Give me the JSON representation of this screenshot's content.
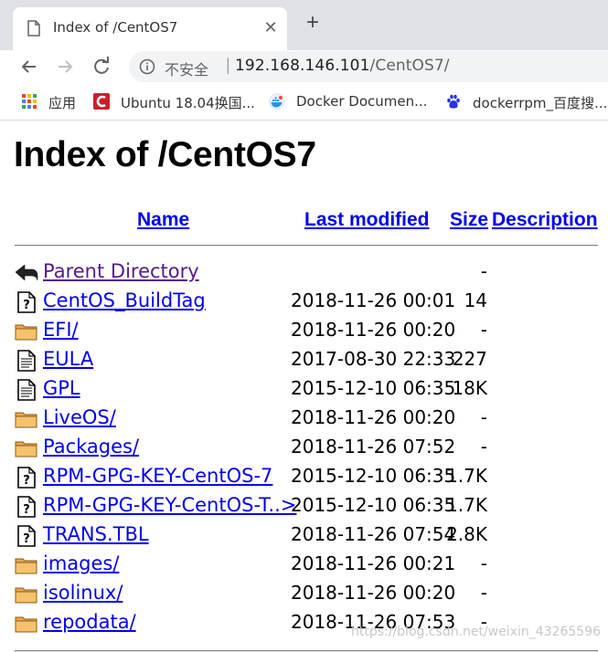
{
  "tab": {
    "title": "Index of /CentOS7",
    "close_glyph": "✕",
    "new_tab_glyph": "+"
  },
  "toolbar": {
    "security_label": "不安全",
    "separator": "|",
    "url_host": "192.168.146.101",
    "url_path": "/CentOS7/"
  },
  "bookmarks": [
    {
      "label": "应用",
      "icon": "apps-grid-icon"
    },
    {
      "label": "Ubuntu 18.04换国...",
      "icon": "ubuntu-c-icon"
    },
    {
      "label": "Docker Documen...",
      "icon": "docker-icon"
    },
    {
      "label": "dockerrpm_百度搜...",
      "icon": "baidu-paw-icon"
    }
  ],
  "page": {
    "title": "Index of /CentOS7",
    "columns": {
      "name": "Name",
      "last_modified": "Last modified",
      "size": "Size",
      "description": "Description"
    },
    "rows": [
      {
        "name": "Parent Directory",
        "date": "",
        "size": "-",
        "icon": "back-arrow-icon"
      },
      {
        "name": "CentOS_BuildTag",
        "date": "2018-11-26 00:01",
        "size": "14",
        "icon": "unknown-file-icon"
      },
      {
        "name": "EFI/",
        "date": "2018-11-26 00:20",
        "size": "-",
        "icon": "folder-icon"
      },
      {
        "name": "EULA",
        "date": "2017-08-30 22:33",
        "size": "227",
        "icon": "text-file-icon"
      },
      {
        "name": "GPL",
        "date": "2015-12-10 06:35",
        "size": "18K",
        "icon": "text-file-icon"
      },
      {
        "name": "LiveOS/",
        "date": "2018-11-26 00:20",
        "size": "-",
        "icon": "folder-icon"
      },
      {
        "name": "Packages/",
        "date": "2018-11-26 07:52",
        "size": "-",
        "icon": "folder-icon"
      },
      {
        "name": "RPM-GPG-KEY-CentOS-7",
        "date": "2015-12-10 06:35",
        "size": "1.7K",
        "icon": "unknown-file-icon"
      },
      {
        "name": "RPM-GPG-KEY-CentOS-T..>",
        "date": "2015-12-10 06:35",
        "size": "1.7K",
        "icon": "unknown-file-icon"
      },
      {
        "name": "TRANS.TBL",
        "date": "2018-11-26 07:54",
        "size": "2.8K",
        "icon": "unknown-file-icon"
      },
      {
        "name": "images/",
        "date": "2018-11-26 00:21",
        "size": "-",
        "icon": "folder-icon"
      },
      {
        "name": "isolinux/",
        "date": "2018-11-26 00:20",
        "size": "-",
        "icon": "folder-icon"
      },
      {
        "name": "repodata/",
        "date": "2018-11-26 07:53",
        "size": "-",
        "icon": "folder-icon"
      }
    ]
  },
  "watermark": "https://blog.csdn.net/weixin_43265596"
}
